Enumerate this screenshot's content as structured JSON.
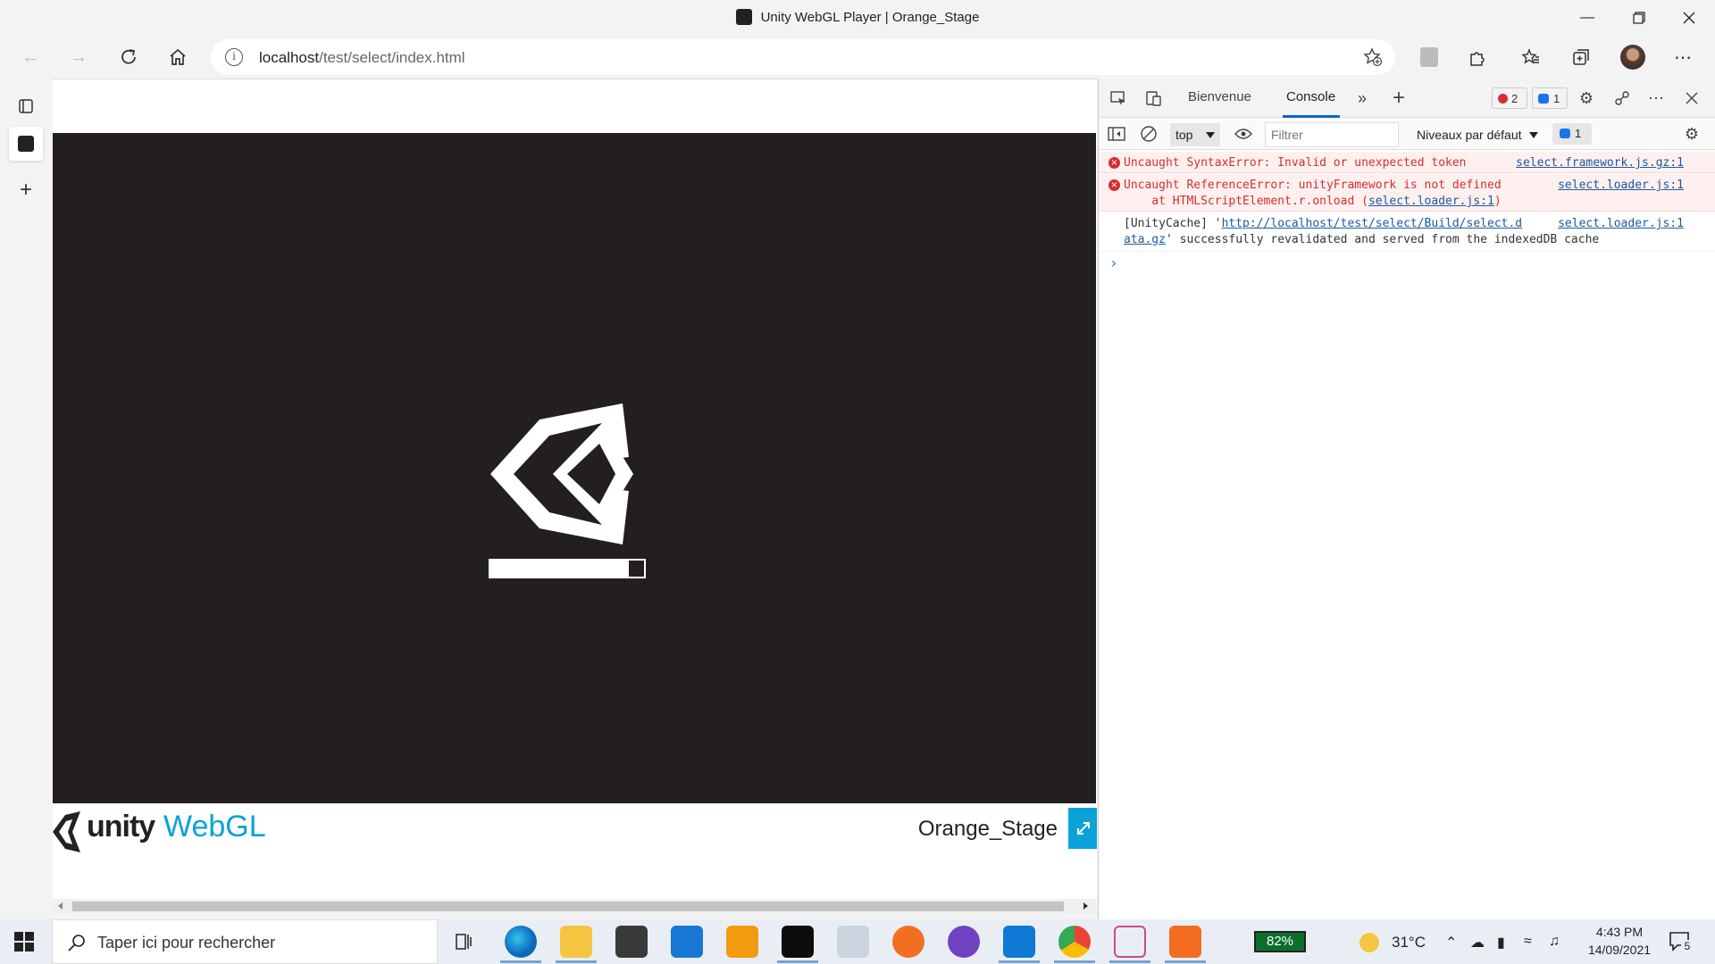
{
  "window": {
    "title": "Unity WebGL Player | Orange_Stage"
  },
  "nav": {
    "url_host": "localhost",
    "url_path": "/test/select/index.html"
  },
  "game": {
    "progress": 0.9,
    "footer_unity": "unity",
    "footer_webgl": "WebGL",
    "footer_title": "Orange_Stage"
  },
  "devtools": {
    "tab_welcome": "Bienvenue",
    "tab_console": "Console",
    "error_count": "2",
    "info_count": "1",
    "context": "top",
    "filter_placeholder": "Filtrer",
    "levels": "Niveaux par défaut",
    "message_count": "1",
    "messages": [
      {
        "type": "error",
        "text": "Uncaught SyntaxError: Invalid or unexpected token",
        "source": "select.framework.js.gz:1"
      },
      {
        "type": "error",
        "text": "Uncaught ReferenceError: unityFramework is not defined",
        "text2_prefix": "    at HTMLScriptElement.r.onload (",
        "text2_link": "select.loader.js:1",
        "text2_suffix": ")",
        "source": "select.loader.js:1"
      },
      {
        "type": "log",
        "prefix": "[UnityCache] '",
        "link_a": "http://localhost/test/select/Build/select.d",
        "link_b": "ata.gz",
        "suffix": "' successfully revalidated and served from the indexedDB cache",
        "source": "select.loader.js:1"
      }
    ],
    "prompt": "›"
  },
  "taskbar": {
    "search_placeholder": "Taper ici pour rechercher",
    "battery": "82%",
    "temperature": "31°C",
    "time": "4:43 PM",
    "date": "14/09/2021",
    "notifications": "5"
  }
}
